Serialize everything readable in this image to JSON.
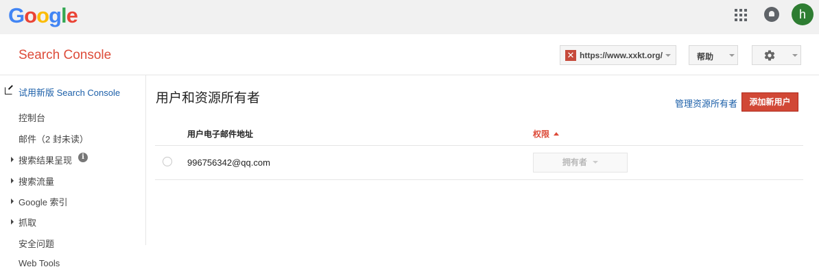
{
  "gbar": {
    "logo_letters": [
      "G",
      "o",
      "o",
      "g",
      "l",
      "e"
    ],
    "avatar_letter": "h",
    "apps_icon": "apps-grid-icon",
    "notification_icon": "notifications-icon"
  },
  "header": {
    "product_title": "Search Console",
    "site_selector": "https://www.xxkt.org/",
    "help_label": "帮助",
    "settings_icon": "gear-icon"
  },
  "sidebar": {
    "items": [
      {
        "label": "试用新版 Search Console",
        "type": "external-link"
      },
      {
        "label": "控制台",
        "type": "plain"
      },
      {
        "label": "邮件（2 封未读）",
        "type": "plain"
      },
      {
        "label": "搜索结果呈现",
        "type": "expandable"
      },
      {
        "label": "搜索流量",
        "type": "expandable"
      },
      {
        "label": "Google 索引",
        "type": "expandable"
      },
      {
        "label": "抓取",
        "type": "expandable"
      },
      {
        "label": "安全问题",
        "type": "plain"
      },
      {
        "label": "Web Tools",
        "type": "plain"
      }
    ]
  },
  "main": {
    "title": "用户和资源所有者",
    "manage_owners_link": "管理资源所有者",
    "add_user_button": "添加新用户",
    "table": {
      "columns": [
        "用户电子邮件地址",
        "权限"
      ],
      "rows": [
        {
          "email": "996756342@qq.com",
          "permission": "拥有者"
        }
      ]
    }
  },
  "colors": {
    "brand_red": "#dd4b39",
    "link_blue": "#1a5ea8",
    "button_red": "#d14836",
    "avatar_green": "#2e7d32"
  }
}
